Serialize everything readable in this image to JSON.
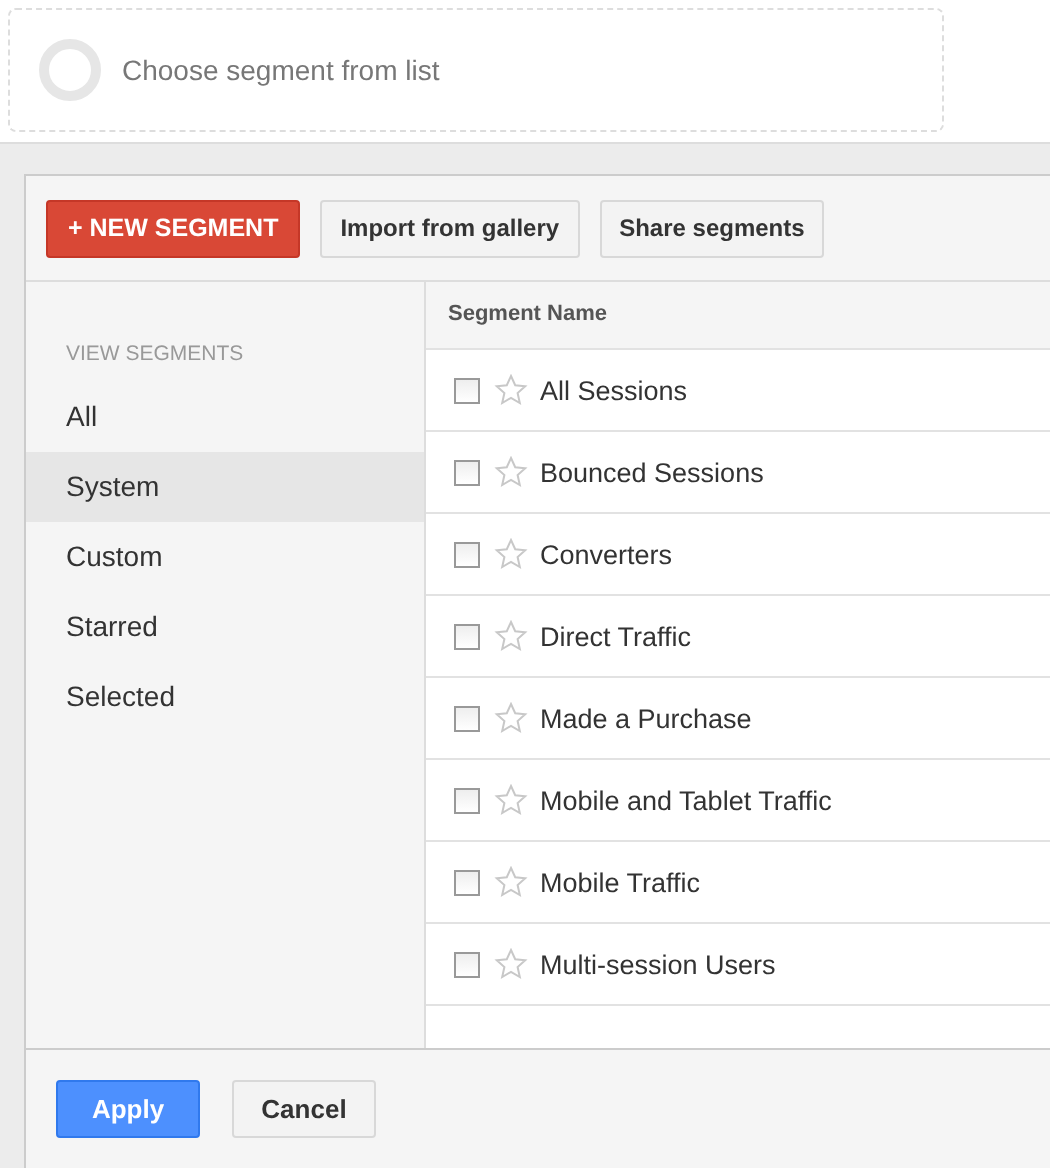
{
  "segment_picker": {
    "placeholder": "Choose segment from list"
  },
  "toolbar": {
    "buttons": [
      {
        "label": "+ NEW SEGMENT",
        "kind": "primary"
      },
      {
        "label": "Import from gallery",
        "kind": "plain"
      },
      {
        "label": "Share segments",
        "kind": "plain"
      }
    ]
  },
  "sidebar": {
    "heading": "VIEW SEGMENTS",
    "items": [
      {
        "label": "All",
        "selected": false
      },
      {
        "label": "System",
        "selected": true
      },
      {
        "label": "Custom",
        "selected": false
      },
      {
        "label": "Starred",
        "selected": false
      },
      {
        "label": "Selected",
        "selected": false
      }
    ]
  },
  "table": {
    "column": "Segment Name",
    "rows": [
      {
        "name": "All Sessions",
        "checked": false,
        "starred": false
      },
      {
        "name": "Bounced Sessions",
        "checked": false,
        "starred": false
      },
      {
        "name": "Converters",
        "checked": false,
        "starred": false
      },
      {
        "name": "Direct Traffic",
        "checked": false,
        "starred": false
      },
      {
        "name": "Made a Purchase",
        "checked": false,
        "starred": false
      },
      {
        "name": "Mobile and Tablet Traffic",
        "checked": false,
        "starred": false
      },
      {
        "name": "Mobile Traffic",
        "checked": false,
        "starred": false
      },
      {
        "name": "Multi-session Users",
        "checked": false,
        "starred": false
      }
    ]
  },
  "footer": {
    "buttons": [
      {
        "label": "Apply",
        "kind": "primary"
      },
      {
        "label": "Cancel",
        "kind": "plain"
      }
    ]
  }
}
